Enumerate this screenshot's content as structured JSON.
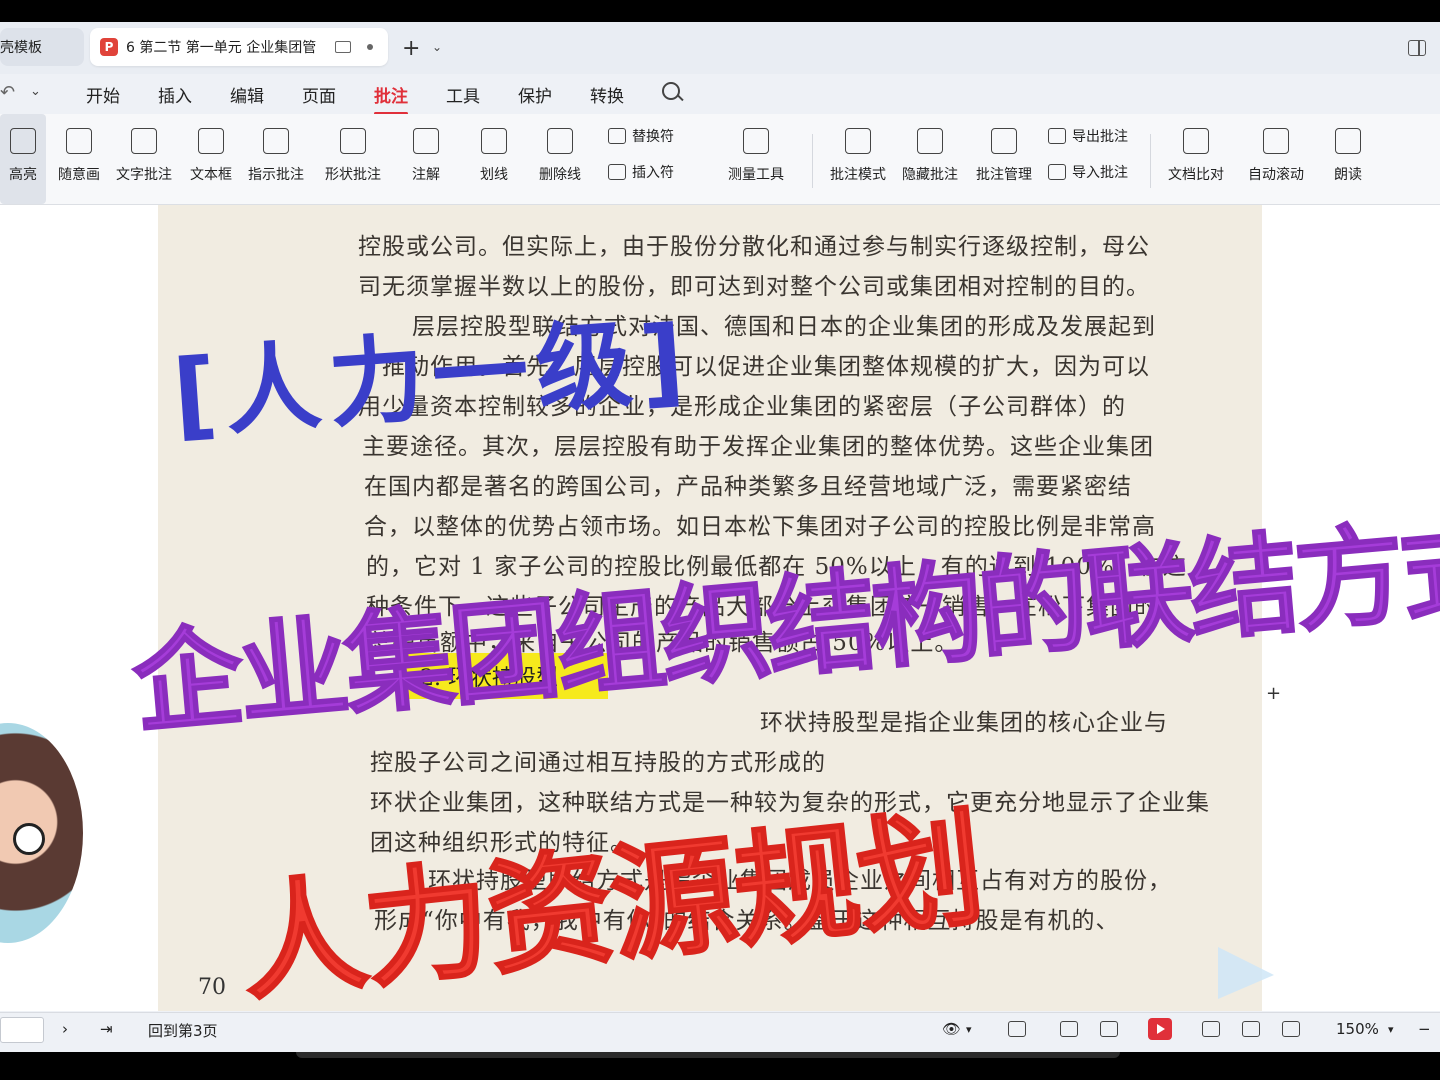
{
  "tabs": {
    "inactive_label": "壳模板",
    "active_label": "6 第二节 第一单元  企业集团管"
  },
  "menu": {
    "items": [
      "开始",
      "插入",
      "编辑",
      "页面",
      "批注",
      "工具",
      "保护",
      "转换"
    ],
    "active": "批注"
  },
  "ribbon": {
    "highlight": "高亮",
    "freehand": "随意画",
    "text_comment": "文字批注",
    "textbox": "文本框",
    "pointer_comment": "指示批注",
    "shape_comment": "形状批注",
    "note": "注解",
    "underline": "划线",
    "strikethrough": "删除线",
    "replace_symbol": "替换符",
    "insert_symbol": "插入符",
    "measure_tool": "测量工具",
    "comment_mode": "批注模式",
    "hide_comments": "隐藏批注",
    "manage_comments": "批注管理",
    "export_comments": "导出批注",
    "import_comments": "导入批注",
    "compare_docs": "文档比对",
    "auto_scroll": "自动滚动",
    "read_aloud": "朗读"
  },
  "document": {
    "lines": [
      "控股或公司。但实际上，由于股份分散化和通过参与制实行逐级控制，母公",
      "司无须掌握半数以上的股份，即可达到对整个公司或集团相对控制的目的。",
      "层层控股型联结方式对法国、德国和日本的企业集团的形成及发展起到",
      "了推动作用。首先，层层控股可以促进企业集团整体规模的扩大，因为可以",
      "用少量资本控制较多的企业，是形成企业集团的紧密层（子公司群体）的",
      "主要途径。其次，层层控股有助于发挥企业集团的整体优势。这些企业集团",
      "在国内都是著名的跨国公司，产品种类繁多且经营地域广泛，需要紧密结",
      "合，以整体的优势占领市场。如日本松下集团对子公司的控股比例是非常高",
      "的，它对 1 家子公司的控股比例最低都在 50%以上，有的达到 100%。在这",
      "种条件下，这些子公司生产的产品大部分上交集团统一销售。在松下集团的",
      "总销售额中，来自子公司的产品的销售额占 50%以上。"
    ],
    "section_heading": "2. 环状持股型",
    "lines2": [
      "环状持股型是指企业集团的核心企业与",
      "控股子公司之间通过相互持股的方式形成的",
      "环状企业集团，这种联结方式是一种较为复杂的形式，它更充分地显示了企业集",
      "团这种组织形式的特征。",
      "环状持股型联结方式是指企业集团成员企业之间相互占有对方的股份，",
      "形成“你中有我，我中有你”的结合关系。鉴于这种相互持股是有机的、"
    ],
    "page_number": "70"
  },
  "overlays": {
    "bracket_title": "[人力一级]",
    "purple_title": "企业集团组织结构的联结方式",
    "red_title": "人力资源规划"
  },
  "status": {
    "back_to_page": "回到第3页",
    "zoom": "150%"
  },
  "colors": {
    "accent": "#e0303a",
    "highlight_yellow": "#f6ea1d",
    "overlay_blue": "#3a3ec9",
    "overlay_purple": "#a53cd9",
    "overlay_red": "#f03a30"
  }
}
